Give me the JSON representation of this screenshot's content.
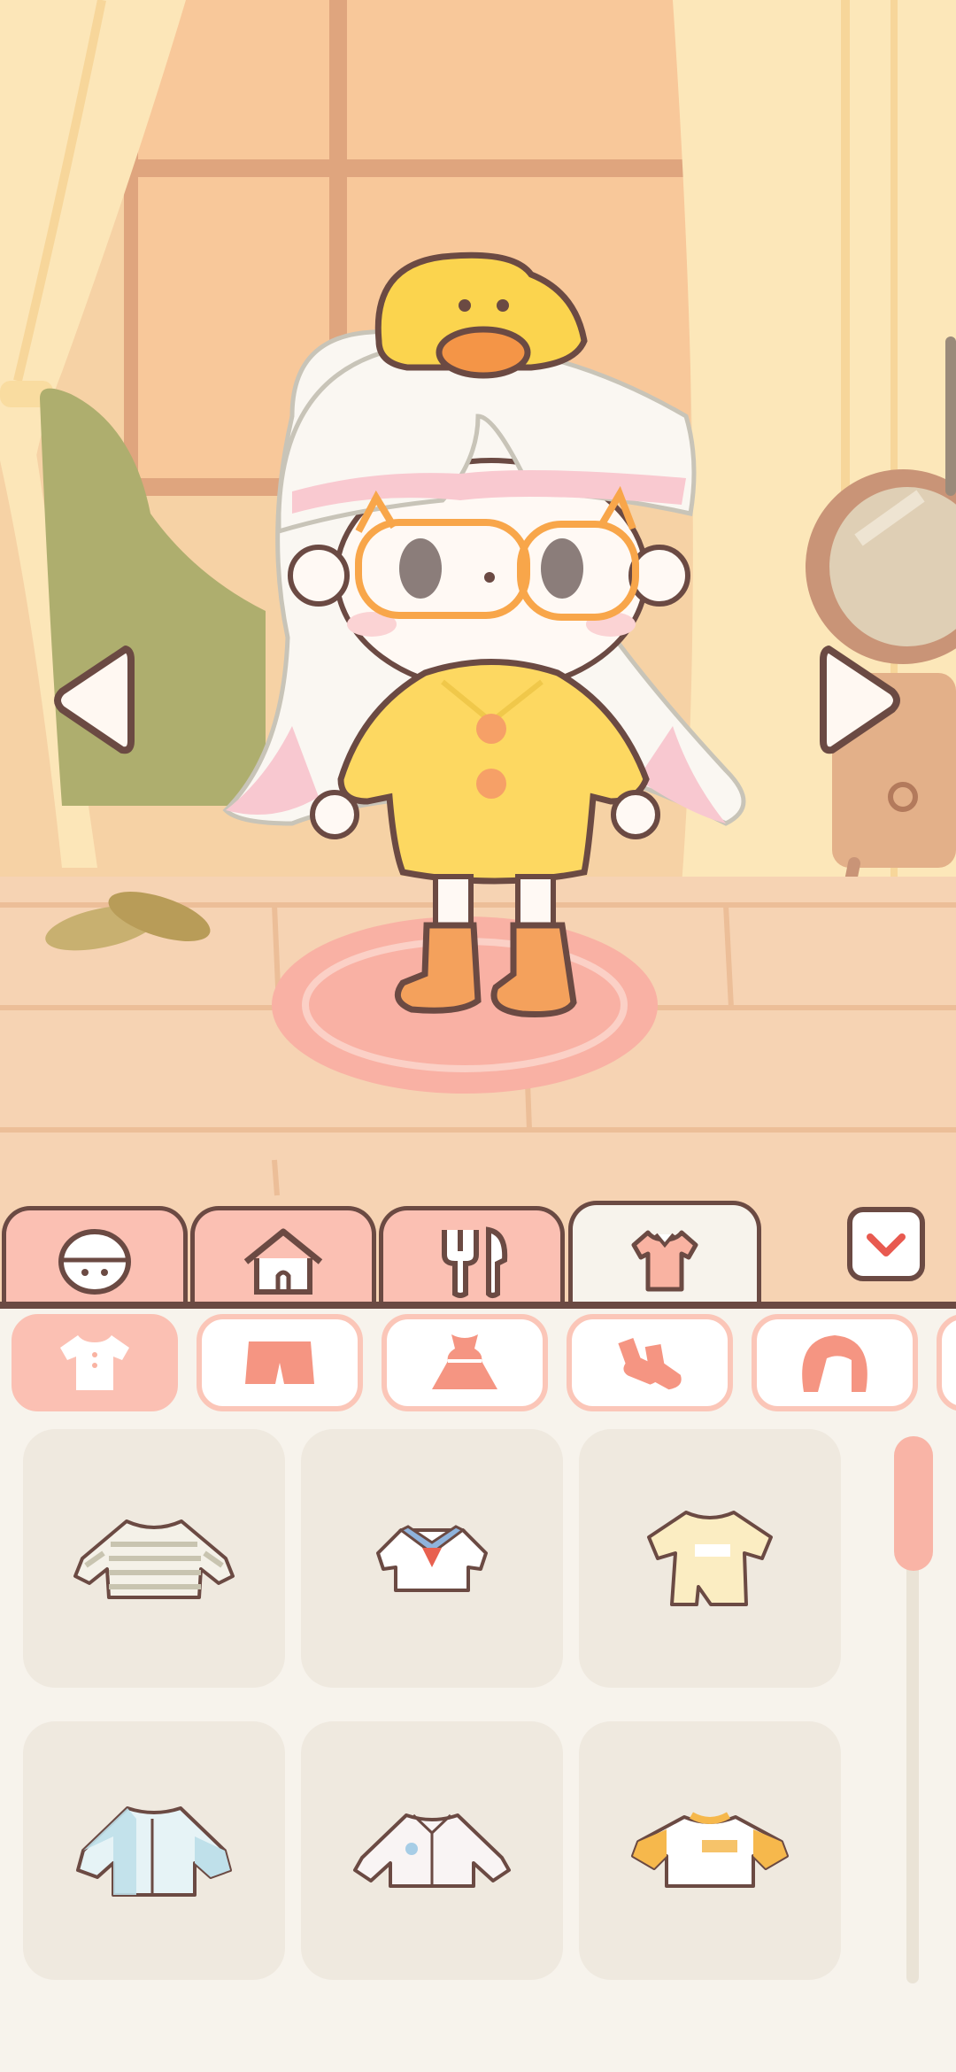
{
  "scene": {
    "character": "chibi-girl",
    "hat": "duck-hat",
    "glasses": "orange-cat-glasses",
    "outfit": "yellow-raincoat",
    "shoes": "orange-boots"
  },
  "navigation": {
    "prev_icon": "left-arrow-icon",
    "next_icon": "right-arrow-icon"
  },
  "main_tabs": [
    {
      "id": "face",
      "icon": "face-icon",
      "active": false
    },
    {
      "id": "house",
      "icon": "house-icon",
      "active": false
    },
    {
      "id": "food",
      "icon": "fork-spoon-icon",
      "active": false
    },
    {
      "id": "clothes",
      "icon": "shirt-icon",
      "active": true
    }
  ],
  "collapse_icon": "chevron-down-icon",
  "sub_tabs": [
    {
      "id": "tops",
      "icon": "top-icon",
      "active": true
    },
    {
      "id": "bottoms",
      "icon": "shorts-icon",
      "active": false
    },
    {
      "id": "dresses",
      "icon": "dress-icon",
      "active": false
    },
    {
      "id": "socks",
      "icon": "socks-icon",
      "active": false
    },
    {
      "id": "hair",
      "icon": "hair-icon",
      "active": false
    }
  ],
  "items": [
    {
      "name": "striped-longsleeve",
      "color": "#d8d4c6"
    },
    {
      "name": "sailor-top",
      "color": "#ffffff"
    },
    {
      "name": "cream-tshirt",
      "color": "#fbeec4"
    },
    {
      "name": "blue-shirt-jacket",
      "color": "#bfe0ea"
    },
    {
      "name": "white-shirt",
      "color": "#f8f3f3"
    },
    {
      "name": "orange-trim-tee",
      "color": "#f6b84c"
    }
  ],
  "colors": {
    "accent": "#fbc0b3",
    "outline": "#6b4a43",
    "panel": "#f7f3ec",
    "item_bg": "#efe9df",
    "check": "#e85a50"
  }
}
